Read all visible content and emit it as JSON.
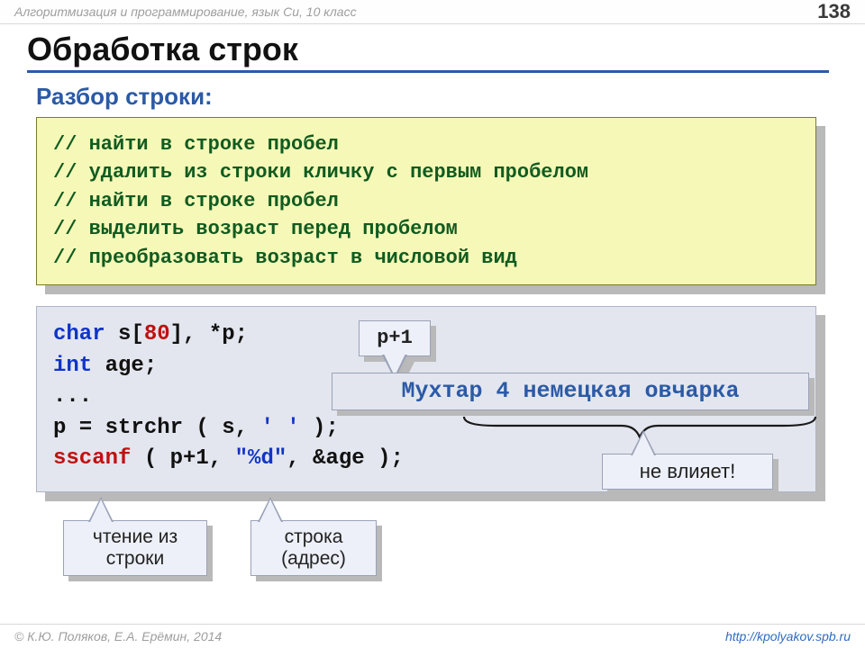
{
  "header": {
    "breadcrumb": "Алгоритмизация и программирование, язык Си, 10 класс",
    "page_number": "138"
  },
  "footer": {
    "copyright": "© К.Ю. Поляков, Е.А. Ерёмин, 2014",
    "url": "http://kpolyakov.spb.ru"
  },
  "title": "Обработка строк",
  "subtitle": "Разбор строки:",
  "comments": [
    "// найти в строке пробел",
    "// удалить из строки кличку с первым пробелом",
    "// найти в строке пробел",
    "// выделить возраст перед пробелом",
    "// преобразовать возраст в числовой вид"
  ],
  "code": {
    "l1_char": "char",
    "l1_rest_a": " s[",
    "l1_num": "80",
    "l1_rest_b": "], *p;",
    "l2_int": "int",
    "l2_rest": " age;",
    "l3": "...",
    "l4_a": "p = strchr ( s, ",
    "l4_str": "' '",
    "l4_b": " );",
    "l5_fn": "sscanf",
    "l5_a": " ( p+1, ",
    "l5_str": "\"%d\"",
    "l5_b": ", &age );"
  },
  "callouts": {
    "pplus1": "p+1",
    "example_string": "Мухтар 4 немецкая овчарка",
    "no_effect": "не влияет!",
    "read_from_string": "чтение из\nстроки",
    "string_address": "строка\n(адрес)"
  }
}
